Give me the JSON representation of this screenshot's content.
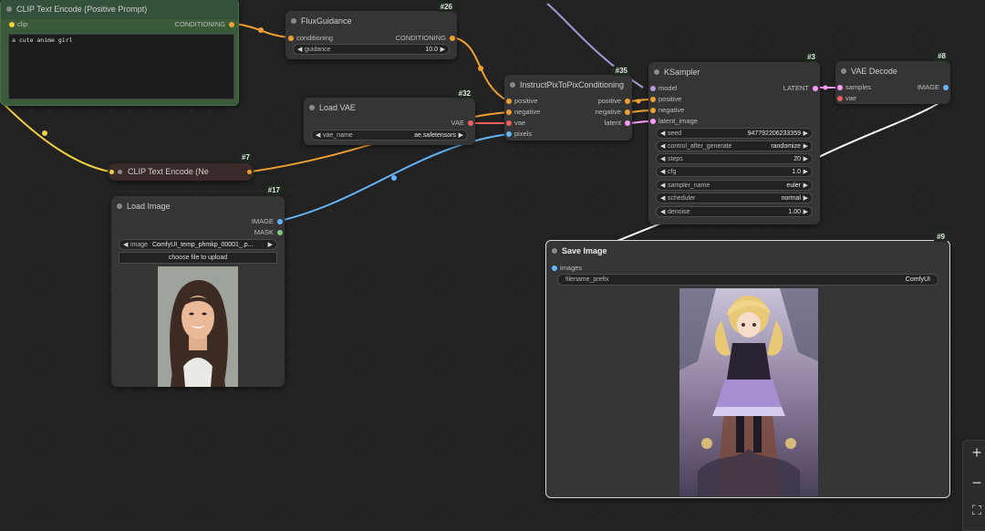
{
  "nodes": {
    "clip_pos": {
      "title": "CLIP Text Encode (Positive Prompt)",
      "in_clip": "clip",
      "out_conditioning": "CONDITIONING",
      "text": "a cute anime girl"
    },
    "flux_guidance": {
      "title": "FluxGuidance",
      "id": "#26",
      "in_conditioning": "conditioning",
      "out_conditioning": "CONDITIONING",
      "guidance_label": "guidance",
      "guidance_value": "10.0"
    },
    "instruct": {
      "title": "InstructPixToPixConditioning",
      "id": "#35",
      "in_positive": "positive",
      "in_negative": "negative",
      "in_vae": "vae",
      "in_pixels": "pixels",
      "out_positive": "positive",
      "out_negative": "negative",
      "out_latent": "latent"
    },
    "load_vae": {
      "title": "Load VAE",
      "id": "#32",
      "out_vae": "VAE",
      "vae_name_label": "vae_name",
      "vae_name_value": "ae.safetensors"
    },
    "clip_neg": {
      "title": "CLIP Text Encode (Ne",
      "id": "#7"
    },
    "load_image": {
      "title": "Load Image",
      "id": "#17",
      "out_image": "IMAGE",
      "out_mask": "MASK",
      "image_label": "image",
      "image_value": "ComfyUI_temp_phmkp_00001_.p...",
      "upload_label": "choose file to upload"
    },
    "ksampler": {
      "title": "KSampler",
      "id": "#3",
      "in_model": "model",
      "in_positive": "positive",
      "in_negative": "negative",
      "in_latent": "latent_image",
      "out_latent": "LATENT",
      "widgets": [
        {
          "label": "seed",
          "value": "947792206233359"
        },
        {
          "label": "control_after_generate",
          "value": "randomize"
        },
        {
          "label": "steps",
          "value": "20"
        },
        {
          "label": "cfg",
          "value": "1.0"
        },
        {
          "label": "sampler_name",
          "value": "euler"
        },
        {
          "label": "scheduler",
          "value": "normal"
        },
        {
          "label": "denoise",
          "value": "1.00"
        }
      ]
    },
    "vae_decode": {
      "title": "VAE Decode",
      "id": "#8",
      "in_samples": "samples",
      "in_vae": "vae",
      "out_image": "IMAGE"
    },
    "save_image": {
      "title": "Save Image",
      "id": "#9",
      "in_images": "images",
      "prefix_label": "filename_prefix",
      "prefix_value": "ComfyUI"
    }
  },
  "zoom": {
    "zoom_in": "+",
    "zoom_out": "−",
    "fit": "⛶"
  },
  "colors": {
    "conditioning": "#f0a030",
    "clip": "#f0d040",
    "vae": "#f06060",
    "image": "#64b5f6",
    "latent": "#ff9cf9",
    "model": "#b39ddb",
    "wire_white": "#ffffff"
  }
}
